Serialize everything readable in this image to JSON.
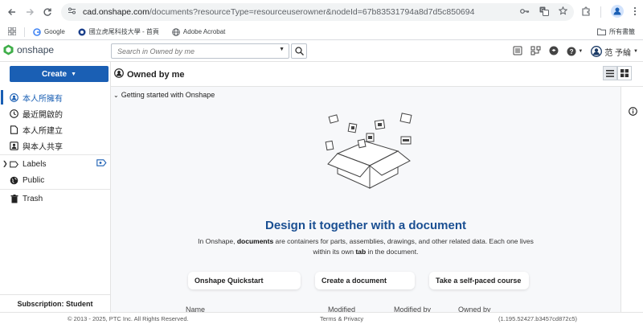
{
  "browser": {
    "url_host": "cad.onshape.com",
    "url_path": "/documents?resourceType=resourceuserowner&nodeId=67b83531794a8d7d5c850694",
    "bookmarks": [
      {
        "label": "Google"
      },
      {
        "label": "國立虎尾科技大學 - 首頁"
      },
      {
        "label": "Adobe Acrobat"
      }
    ],
    "all_bookmarks": "所有書籤"
  },
  "header": {
    "logo_text": "onshape",
    "search_placeholder": "Search in Owned by me",
    "user_name": "范 予綸"
  },
  "sidebar": {
    "create_label": "Create",
    "items": [
      {
        "label": "本人所擁有"
      },
      {
        "label": "最近開啟的"
      },
      {
        "label": "本人所建立"
      },
      {
        "label": "與本人共享"
      },
      {
        "label": "Labels"
      },
      {
        "label": "Public"
      },
      {
        "label": "Trash"
      }
    ],
    "subscription": "Subscription: Student"
  },
  "main": {
    "title": "Owned by me",
    "section_toggle": "Getting started with Onshape",
    "hero_title": "Design it together with a document",
    "desc_1": "In Onshape, ",
    "desc_b1": "documents",
    "desc_2": " are containers for parts, assemblies, drawings, and other related data. Each one lives within its own ",
    "desc_b2": "tab",
    "desc_3": " in the document.",
    "cards": [
      {
        "label": "Onshape Quickstart"
      },
      {
        "label": "Create a document"
      },
      {
        "label": "Take a self-paced course"
      }
    ],
    "columns": [
      "Name",
      "Modified",
      "Modified by",
      "Owned by"
    ]
  },
  "footer": {
    "copyright": "© 2013 - 2025, PTC Inc. All Rights Reserved.",
    "terms": "Terms & Privacy",
    "version": "(1.195.52427.b3457cd872c5)"
  },
  "colors": {
    "accent": "#1a5fb4",
    "hero_title": "#1a4f92",
    "logo_green": "#3fae49"
  }
}
